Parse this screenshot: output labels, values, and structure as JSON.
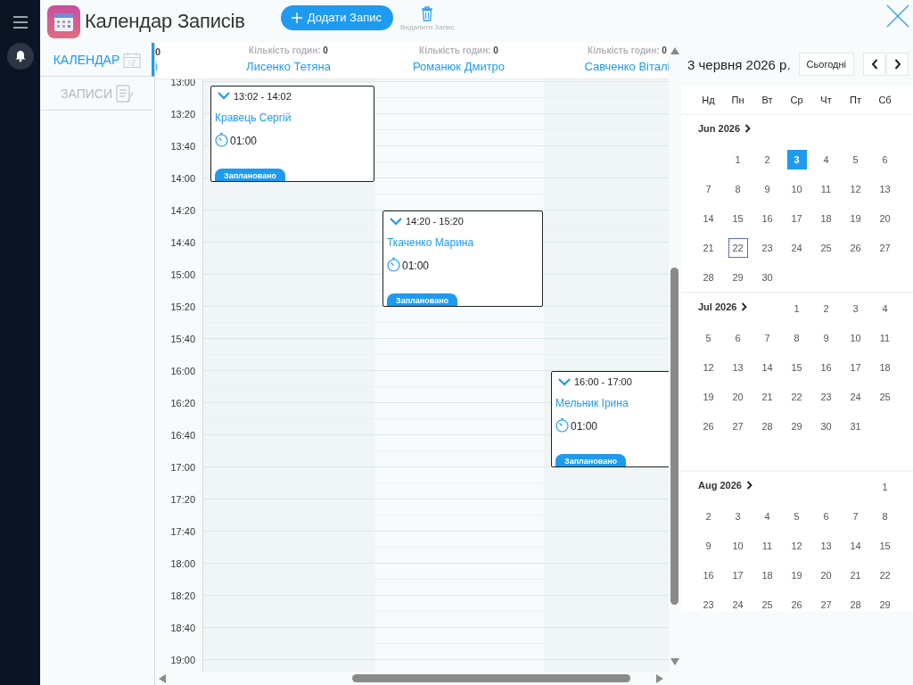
{
  "app": {
    "title": "Календар Записів"
  },
  "toolbar": {
    "add_button": "Додати Запис",
    "delete_label": "Видалити Запис"
  },
  "nav": [
    {
      "label": "КАЛЕНДАР",
      "kind": "calendar",
      "selected": true
    },
    {
      "label": "ЗАПИСИ",
      "kind": "records",
      "selected": false
    }
  ],
  "schedule": {
    "partial_column": {
      "hours_value": "0",
      "name": "і"
    },
    "columns": [
      {
        "hours_label": "Кількість годин:",
        "hours_value": "0",
        "name": "Лисенко Тетяна",
        "appointments": [
          {
            "time": "13:02 - 14:02",
            "client": "Кравець Сергій",
            "duration": "01:00",
            "status": "Заплановано"
          }
        ]
      },
      {
        "hours_label": "Кількість годин:",
        "hours_value": "0",
        "name": "Романюк Дмитро",
        "appointments": [
          {
            "time": "14:20 - 15:20",
            "client": "Ткаченко Марина",
            "duration": "01:00",
            "status": "Заплановано"
          }
        ]
      },
      {
        "hours_label": "Кількість годин:",
        "hours_value": "0",
        "name": "Савченко Віталі",
        "appointments": [
          {
            "time": "16:00 - 17:00",
            "client": "Мельник Ірина",
            "duration": "01:00",
            "status": "Заплановано"
          }
        ]
      }
    ],
    "times": [
      "13:00",
      "13:20",
      "13:40",
      "14:00",
      "14:20",
      "14:40",
      "15:00",
      "15:20",
      "15:40",
      "16:00",
      "16:20",
      "16:40",
      "17:00",
      "17:20",
      "17:40",
      "18:00",
      "18:20",
      "18:40",
      "19:00"
    ]
  },
  "calendar": {
    "date_title": "3 червня 2026 р.",
    "today_button": "Сьогодні",
    "weekdays": [
      "Нд",
      "Пн",
      "Вт",
      "Ср",
      "Чт",
      "Пт",
      "Сб"
    ],
    "months": [
      {
        "label": "Jun 2026",
        "weeks": [
          [
            {
              "kind": "blank"
            },
            {
              "kind": "day",
              "d": "1",
              "selected": false,
              "marked": false
            },
            {
              "kind": "day",
              "d": "2",
              "selected": false,
              "marked": false
            },
            {
              "kind": "day",
              "d": "3",
              "selected": true,
              "marked": false
            },
            {
              "kind": "day",
              "d": "4",
              "selected": false,
              "marked": false
            },
            {
              "kind": "day",
              "d": "5",
              "selected": false,
              "marked": false
            },
            {
              "kind": "day",
              "d": "6",
              "selected": false,
              "marked": false
            }
          ],
          [
            {
              "kind": "day",
              "d": "7",
              "selected": false,
              "marked": false
            },
            {
              "kind": "day",
              "d": "8",
              "selected": false,
              "marked": false
            },
            {
              "kind": "day",
              "d": "9",
              "selected": false,
              "marked": false
            },
            {
              "kind": "day",
              "d": "10",
              "selected": false,
              "marked": false
            },
            {
              "kind": "day",
              "d": "11",
              "selected": false,
              "marked": false
            },
            {
              "kind": "day",
              "d": "12",
              "selected": false,
              "marked": false
            },
            {
              "kind": "day",
              "d": "13",
              "selected": false,
              "marked": false
            }
          ],
          [
            {
              "kind": "day",
              "d": "14",
              "selected": false,
              "marked": false
            },
            {
              "kind": "day",
              "d": "15",
              "selected": false,
              "marked": false
            },
            {
              "kind": "day",
              "d": "16",
              "selected": false,
              "marked": false
            },
            {
              "kind": "day",
              "d": "17",
              "selected": false,
              "marked": false
            },
            {
              "kind": "day",
              "d": "18",
              "selected": false,
              "marked": false
            },
            {
              "kind": "day",
              "d": "19",
              "selected": false,
              "marked": false
            },
            {
              "kind": "day",
              "d": "20",
              "selected": false,
              "marked": false
            }
          ],
          [
            {
              "kind": "day",
              "d": "21",
              "selected": false,
              "marked": false
            },
            {
              "kind": "day",
              "d": "22",
              "selected": false,
              "marked": true
            },
            {
              "kind": "day",
              "d": "23",
              "selected": false,
              "marked": false
            },
            {
              "kind": "day",
              "d": "24",
              "selected": false,
              "marked": false
            },
            {
              "kind": "day",
              "d": "25",
              "selected": false,
              "marked": false
            },
            {
              "kind": "day",
              "d": "26",
              "selected": false,
              "marked": false
            },
            {
              "kind": "day",
              "d": "27",
              "selected": false,
              "marked": false
            }
          ],
          [
            {
              "kind": "day",
              "d": "28",
              "selected": false,
              "marked": false
            },
            {
              "kind": "day",
              "d": "29",
              "selected": false,
              "marked": false
            },
            {
              "kind": "day",
              "d": "30",
              "selected": false,
              "marked": false
            }
          ]
        ]
      },
      {
        "label": "Jul 2026",
        "weeks": [
          [
            {
              "kind": "blank"
            },
            {
              "kind": "blank"
            },
            {
              "kind": "blank"
            },
            {
              "kind": "day",
              "d": "1",
              "selected": false,
              "marked": false
            },
            {
              "kind": "day",
              "d": "2",
              "selected": false,
              "marked": false
            },
            {
              "kind": "day",
              "d": "3",
              "selected": false,
              "marked": false
            },
            {
              "kind": "day",
              "d": "4",
              "selected": false,
              "marked": false
            }
          ],
          [
            {
              "kind": "day",
              "d": "5",
              "selected": false,
              "marked": false
            },
            {
              "kind": "day",
              "d": "6",
              "selected": false,
              "marked": false
            },
            {
              "kind": "day",
              "d": "7",
              "selected": false,
              "marked": false
            },
            {
              "kind": "day",
              "d": "8",
              "selected": false,
              "marked": false
            },
            {
              "kind": "day",
              "d": "9",
              "selected": false,
              "marked": false
            },
            {
              "kind": "day",
              "d": "10",
              "selected": false,
              "marked": false
            },
            {
              "kind": "day",
              "d": "11",
              "selected": false,
              "marked": false
            }
          ],
          [
            {
              "kind": "day",
              "d": "12",
              "selected": false,
              "marked": false
            },
            {
              "kind": "day",
              "d": "13",
              "selected": false,
              "marked": false
            },
            {
              "kind": "day",
              "d": "14",
              "selected": false,
              "marked": false
            },
            {
              "kind": "day",
              "d": "15",
              "selected": false,
              "marked": false
            },
            {
              "kind": "day",
              "d": "16",
              "selected": false,
              "marked": false
            },
            {
              "kind": "day",
              "d": "17",
              "selected": false,
              "marked": false
            },
            {
              "kind": "day",
              "d": "18",
              "selected": false,
              "marked": false
            }
          ],
          [
            {
              "kind": "day",
              "d": "19",
              "selected": false,
              "marked": false
            },
            {
              "kind": "day",
              "d": "20",
              "selected": false,
              "marked": false
            },
            {
              "kind": "day",
              "d": "21",
              "selected": false,
              "marked": false
            },
            {
              "kind": "day",
              "d": "22",
              "selected": false,
              "marked": false
            },
            {
              "kind": "day",
              "d": "23",
              "selected": false,
              "marked": false
            },
            {
              "kind": "day",
              "d": "24",
              "selected": false,
              "marked": false
            },
            {
              "kind": "day",
              "d": "25",
              "selected": false,
              "marked": false
            }
          ],
          [
            {
              "kind": "day",
              "d": "26",
              "selected": false,
              "marked": false
            },
            {
              "kind": "day",
              "d": "27",
              "selected": false,
              "marked": false
            },
            {
              "kind": "day",
              "d": "28",
              "selected": false,
              "marked": false
            },
            {
              "kind": "day",
              "d": "29",
              "selected": false,
              "marked": false
            },
            {
              "kind": "day",
              "d": "30",
              "selected": false,
              "marked": false
            },
            {
              "kind": "day",
              "d": "31",
              "selected": false,
              "marked": false
            }
          ]
        ]
      },
      {
        "label": "Aug 2026",
        "weeks": [
          [
            {
              "kind": "blank"
            },
            {
              "kind": "blank"
            },
            {
              "kind": "blank"
            },
            {
              "kind": "blank"
            },
            {
              "kind": "blank"
            },
            {
              "kind": "blank"
            },
            {
              "kind": "day",
              "d": "1",
              "selected": false,
              "marked": false
            }
          ],
          [
            {
              "kind": "day",
              "d": "2",
              "selected": false,
              "marked": false
            },
            {
              "kind": "day",
              "d": "3",
              "selected": false,
              "marked": false
            },
            {
              "kind": "day",
              "d": "4",
              "selected": false,
              "marked": false
            },
            {
              "kind": "day",
              "d": "5",
              "selected": false,
              "marked": false
            },
            {
              "kind": "day",
              "d": "6",
              "selected": false,
              "marked": false
            },
            {
              "kind": "day",
              "d": "7",
              "selected": false,
              "marked": false
            },
            {
              "kind": "day",
              "d": "8",
              "selected": false,
              "marked": false
            }
          ],
          [
            {
              "kind": "day",
              "d": "9",
              "selected": false,
              "marked": false
            },
            {
              "kind": "day",
              "d": "10",
              "selected": false,
              "marked": false
            },
            {
              "kind": "day",
              "d": "11",
              "selected": false,
              "marked": false
            },
            {
              "kind": "day",
              "d": "12",
              "selected": false,
              "marked": false
            },
            {
              "kind": "day",
              "d": "13",
              "selected": false,
              "marked": false
            },
            {
              "kind": "day",
              "d": "14",
              "selected": false,
              "marked": false
            },
            {
              "kind": "day",
              "d": "15",
              "selected": false,
              "marked": false
            }
          ],
          [
            {
              "kind": "day",
              "d": "16",
              "selected": false,
              "marked": false
            },
            {
              "kind": "day",
              "d": "17",
              "selected": false,
              "marked": false
            },
            {
              "kind": "day",
              "d": "18",
              "selected": false,
              "marked": false
            },
            {
              "kind": "day",
              "d": "19",
              "selected": false,
              "marked": false
            },
            {
              "kind": "day",
              "d": "20",
              "selected": false,
              "marked": false
            },
            {
              "kind": "day",
              "d": "21",
              "selected": false,
              "marked": false
            },
            {
              "kind": "day",
              "d": "22",
              "selected": false,
              "marked": false
            }
          ],
          [
            {
              "kind": "day",
              "d": "23",
              "selected": false,
              "marked": false
            },
            {
              "kind": "day",
              "d": "24",
              "selected": false,
              "marked": false
            },
            {
              "kind": "day",
              "d": "25",
              "selected": false,
              "marked": false
            },
            {
              "kind": "day",
              "d": "26",
              "selected": false,
              "marked": false
            },
            {
              "kind": "day",
              "d": "27",
              "selected": false,
              "marked": false
            },
            {
              "kind": "day",
              "d": "28",
              "selected": false,
              "marked": false
            },
            {
              "kind": "day",
              "d": "29",
              "selected": false,
              "marked": false
            }
          ]
        ]
      }
    ]
  }
}
